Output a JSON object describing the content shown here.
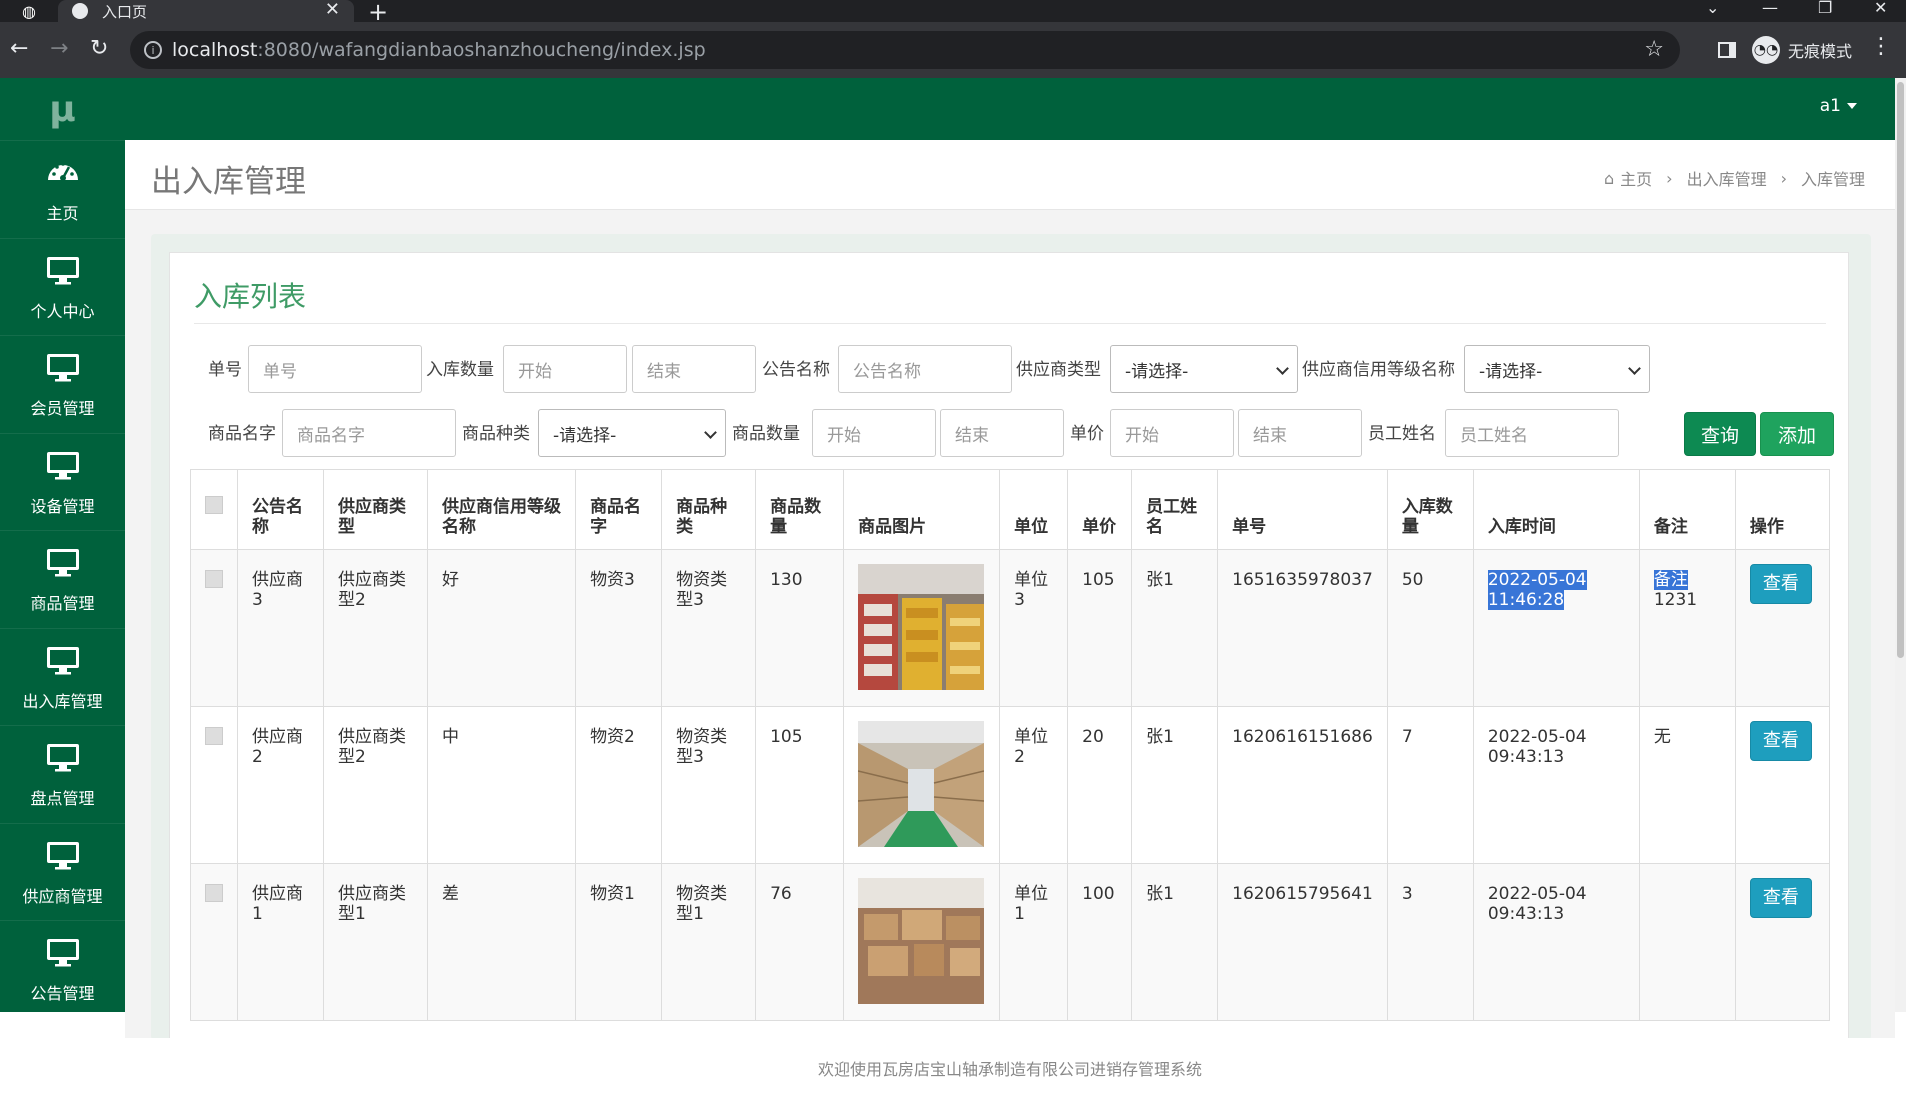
{
  "browser": {
    "other_tab_icon": "globe-icon",
    "tab_title": "入口页",
    "url_host": "localhost",
    "url_rest": ":8080/wafangdianbaoshanzhoucheng/index.jsp",
    "incognito_label": "无痕模式"
  },
  "sidebar": {
    "logo": "μ",
    "items": [
      {
        "label": "主页",
        "icon": "dashboard-icon"
      },
      {
        "label": "个人中心",
        "icon": "monitor-icon"
      },
      {
        "label": "会员管理",
        "icon": "monitor-icon"
      },
      {
        "label": "设备管理",
        "icon": "monitor-icon"
      },
      {
        "label": "商品管理",
        "icon": "monitor-icon"
      },
      {
        "label": "出入库管理",
        "icon": "monitor-icon"
      },
      {
        "label": "盘点管理",
        "icon": "monitor-icon"
      },
      {
        "label": "供应商管理",
        "icon": "monitor-icon"
      },
      {
        "label": "公告管理",
        "icon": "monitor-icon"
      }
    ]
  },
  "topnav": {
    "user": "a1"
  },
  "header": {
    "title": "出入库管理",
    "breadcrumb": [
      "主页",
      "出入库管理",
      "入库管理"
    ]
  },
  "panel": {
    "title": "入库列表",
    "filters": {
      "danhao_label": "单号",
      "danhao_ph": "单号",
      "rkqty_label": "入库数量",
      "start_ph": "开始",
      "end_ph": "结束",
      "notice_label": "公告名称",
      "notice_ph": "公告名称",
      "suptype_label": "供应商类型",
      "select_ph": "-请选择-",
      "credit_label": "供应商信用等级名称",
      "goodsname_label": "商品名字",
      "goodsname_ph": "商品名字",
      "goodstype_label": "商品种类",
      "goodsqty_label": "商品数量",
      "price_label": "单价",
      "staff_label": "员工姓名",
      "staff_ph": "员工姓名",
      "query_btn": "查询",
      "add_btn": "添加"
    },
    "table": {
      "headers": [
        "公告名称",
        "供应商类型",
        "供应商信用等级名称",
        "商品名字",
        "商品种类",
        "商品数量",
        "商品图片",
        "单位",
        "单价",
        "员工姓名",
        "单号",
        "入库数量",
        "入库时间",
        "备注",
        "操作"
      ],
      "rows": [
        {
          "notice": "供应商3",
          "suptype": "供应商类型2",
          "credit": "好",
          "name": "物资3",
          "kind": "物资类型3",
          "qty": "130",
          "img": "yellow-sacks-warehouse",
          "unit": "单位3",
          "price": "105",
          "staff": "张1",
          "no": "1651635978037",
          "inqty": "50",
          "time": "2022-05-04 11:46:28",
          "note": "备注1231",
          "note_sel": "备注",
          "note_rest": "1231",
          "op": "查看"
        },
        {
          "notice": "供应商2",
          "suptype": "供应商类型2",
          "credit": "中",
          "name": "物资2",
          "kind": "物资类型3",
          "qty": "105",
          "img": "warehouse-aisle-boxes",
          "unit": "单位2",
          "price": "20",
          "staff": "张1",
          "no": "1620616151686",
          "inqty": "7",
          "time": "2022-05-04 09:43:13",
          "note": "无",
          "op": "查看"
        },
        {
          "notice": "供应商1",
          "suptype": "供应商类型1",
          "credit": "差",
          "name": "物资1",
          "kind": "物资类型1",
          "qty": "76",
          "img": "cardboard-boxes-storage",
          "unit": "单位1",
          "price": "100",
          "staff": "张1",
          "no": "1620615795641",
          "inqty": "3",
          "time": "2022-05-04 09:43:13",
          "note": "",
          "op": "查看"
        }
      ]
    }
  },
  "footer": "欢迎使用瓦房店宝山轴承制造有限公司进销存管理系统",
  "colors": {
    "sidebar": "#00613c",
    "accent": "#3f9b66",
    "view_btn": "#1e9ebe"
  }
}
